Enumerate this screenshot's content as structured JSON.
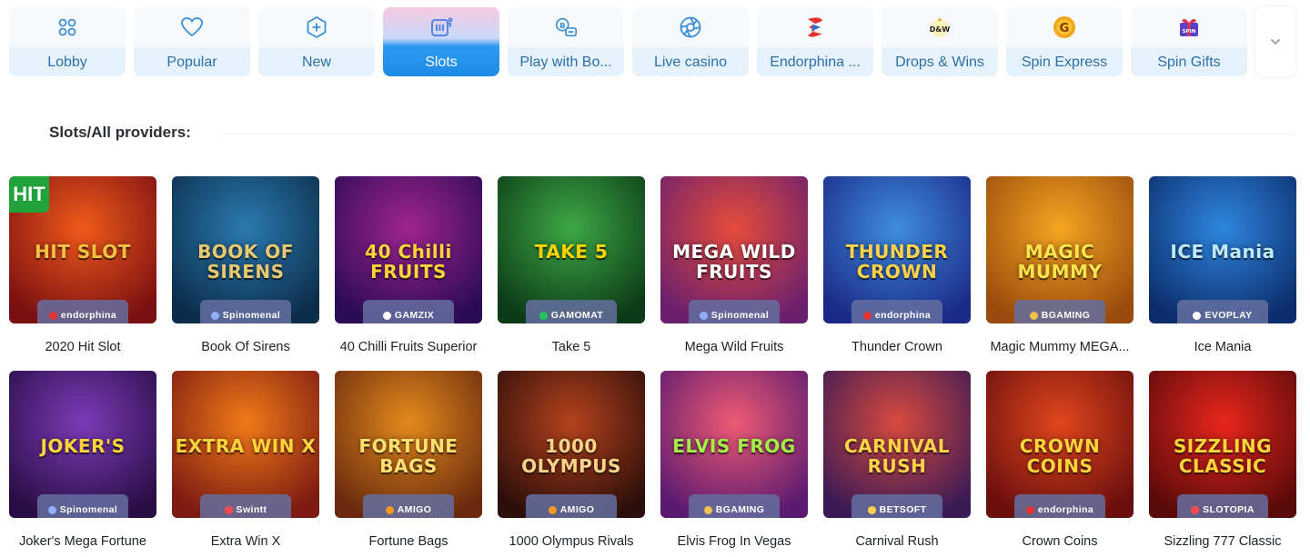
{
  "tabs": [
    {
      "label": "Lobby",
      "icon": "grid-icon",
      "active": false
    },
    {
      "label": "Popular",
      "icon": "heart-icon",
      "active": false
    },
    {
      "label": "New",
      "icon": "plus-hexagon-icon",
      "active": false
    },
    {
      "label": "Slots",
      "icon": "slot-machine-icon",
      "active": true
    },
    {
      "label": "Play with Bo...",
      "icon": "bonus-coin-icon",
      "active": false
    },
    {
      "label": "Live casino",
      "icon": "camera-aperture-icon",
      "active": false
    },
    {
      "label": "Endorphina ...",
      "icon": "endorphina-logo-icon",
      "active": false
    },
    {
      "label": "Drops & Wins",
      "icon": "drops-wins-logo-icon",
      "active": false
    },
    {
      "label": "Spin Express",
      "icon": "spin-express-logo-icon",
      "active": false
    },
    {
      "label": "Spin Gifts",
      "icon": "spin-gifts-logo-icon",
      "active": false
    }
  ],
  "more_icon": "chevron-down-icon",
  "section": {
    "title": "Slots/All providers:"
  },
  "games": [
    {
      "title": "2020 Hit Slot",
      "provider": "endorphina",
      "art_text": "HIT SLOT",
      "corner": "HIT",
      "bg": [
        "#f05a1a",
        "#7a0f12"
      ],
      "accent": "#f4c243"
    },
    {
      "title": "Book Of Sirens",
      "provider": "Spinomenal",
      "art_text": "BOOK OF SIRENS",
      "bg": [
        "#2a7ab0",
        "#0c2d4a"
      ],
      "accent": "#e8c871"
    },
    {
      "title": "40 Chilli Fruits Superior",
      "provider": "GAMZIX",
      "art_text": "40 Chilli FRUITS",
      "bg": [
        "#a0248f",
        "#2b0b55"
      ],
      "accent": "#ffd43a"
    },
    {
      "title": "Take 5",
      "provider": "GAMOMAT",
      "art_text": "TAKE 5",
      "bg": [
        "#3da845",
        "#0c3a17"
      ],
      "accent": "#ffd400"
    },
    {
      "title": "Mega Wild Fruits",
      "provider": "Spinomenal",
      "art_text": "MEGA WILD FRUITS",
      "bg": [
        "#e64c3a",
        "#6a1f6e"
      ],
      "accent": "#ffffff"
    },
    {
      "title": "Thunder Crown",
      "provider": "endorphina",
      "art_text": "THUNDER CROWN",
      "bg": [
        "#3f8de0",
        "#1b2a86"
      ],
      "accent": "#ffd24a"
    },
    {
      "title": "Magic Mummy MEGA...",
      "provider": "BGAMING",
      "art_text": "MAGIC MUMMY",
      "bg": [
        "#f3a521",
        "#9a4a0c"
      ],
      "accent": "#ffe34a"
    },
    {
      "title": "Ice Mania",
      "provider": "EVOPLAY",
      "art_text": "ICE Mania",
      "bg": [
        "#2e86e0",
        "#0c2d6b"
      ],
      "accent": "#bde9ff"
    },
    {
      "title": "Joker's Mega Fortune",
      "provider": "Spinomenal",
      "art_text": "JOKER'S",
      "bg": [
        "#7c3bb8",
        "#2a0d45"
      ],
      "accent": "#ffd43a"
    },
    {
      "title": "Extra Win X",
      "provider": "Swintt",
      "art_text": "EXTRA WIN X",
      "bg": [
        "#f07a18",
        "#7d1a12"
      ],
      "accent": "#ffd43a"
    },
    {
      "title": "Fortune Bags",
      "provider": "AMIGO",
      "art_text": "FORTUNE BAGS",
      "bg": [
        "#e38a1c",
        "#6b2a0e"
      ],
      "accent": "#ffe070"
    },
    {
      "title": "1000 Olympus Rivals",
      "provider": "AMIGO",
      "art_text": "1000 OLYMPUS",
      "bg": [
        "#b5421c",
        "#2c0e0a"
      ],
      "accent": "#f6d58a"
    },
    {
      "title": "Elvis Frog In Vegas",
      "provider": "BGAMING",
      "art_text": "ELVIS FROG",
      "bg": [
        "#ee5a73",
        "#5a1a70"
      ],
      "accent": "#a4ee4a"
    },
    {
      "title": "Carnival Rush",
      "provider": "BETSOFT",
      "art_text": "CARNIVAL RUSH",
      "bg": [
        "#d84a3e",
        "#3a1a55"
      ],
      "accent": "#ffd24a"
    },
    {
      "title": "Crown Coins",
      "provider": "endorphina",
      "art_text": "CROWN COINS",
      "bg": [
        "#e0461c",
        "#6a0e0e"
      ],
      "accent": "#ffd43a"
    },
    {
      "title": "Sizzling 777 Classic",
      "provider": "SLOTOPIA",
      "art_text": "SIZZLING CLASSIC",
      "bg": [
        "#e8261c",
        "#5a0a0a"
      ],
      "accent": "#ffd43a"
    }
  ],
  "colors": {
    "tab_text": "#2d6fa8",
    "tab_active": "#1e8ae8",
    "badge_bg": "#6c74a4"
  }
}
